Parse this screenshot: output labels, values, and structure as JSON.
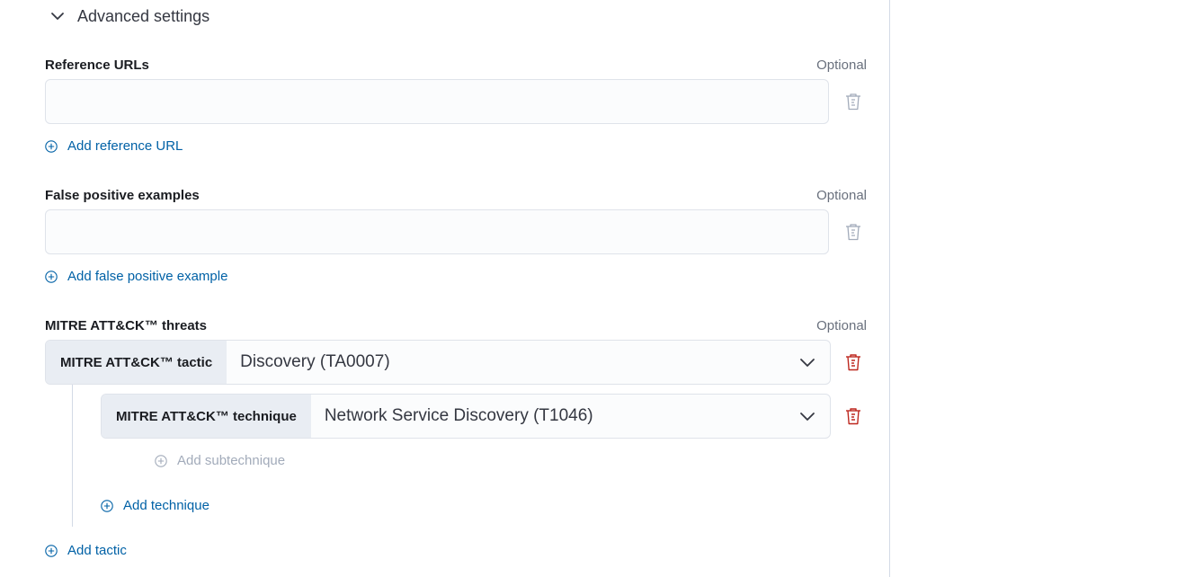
{
  "advanced": {
    "label": "Advanced settings"
  },
  "reference_urls": {
    "label": "Reference URLs",
    "optional": "Optional",
    "value": "",
    "add_label": "Add reference URL"
  },
  "false_positives": {
    "label": "False positive examples",
    "optional": "Optional",
    "value": "",
    "add_label": "Add false positive example"
  },
  "mitre": {
    "label": "MITRE ATT&CK™ threats",
    "optional": "Optional",
    "tactic_prepend": "MITRE ATT&CK™ tactic",
    "tactic_value": "Discovery (TA0007)",
    "technique_prepend": "MITRE ATT&CK™ technique",
    "technique_value": "Network Service Discovery (T1046)",
    "add_subtechnique": "Add subtechnique",
    "add_technique": "Add technique",
    "add_tactic": "Add tactic"
  },
  "colors": {
    "link": "#0061a6",
    "danger": "#bd271e",
    "disabled": "#a2abba",
    "prepend_bg": "#e9edf3"
  },
  "icons": {
    "toggle": "chevron-down-icon",
    "delete": "trash-icon",
    "add": "plus-in-circle-icon",
    "select": "chevron-down-icon"
  }
}
